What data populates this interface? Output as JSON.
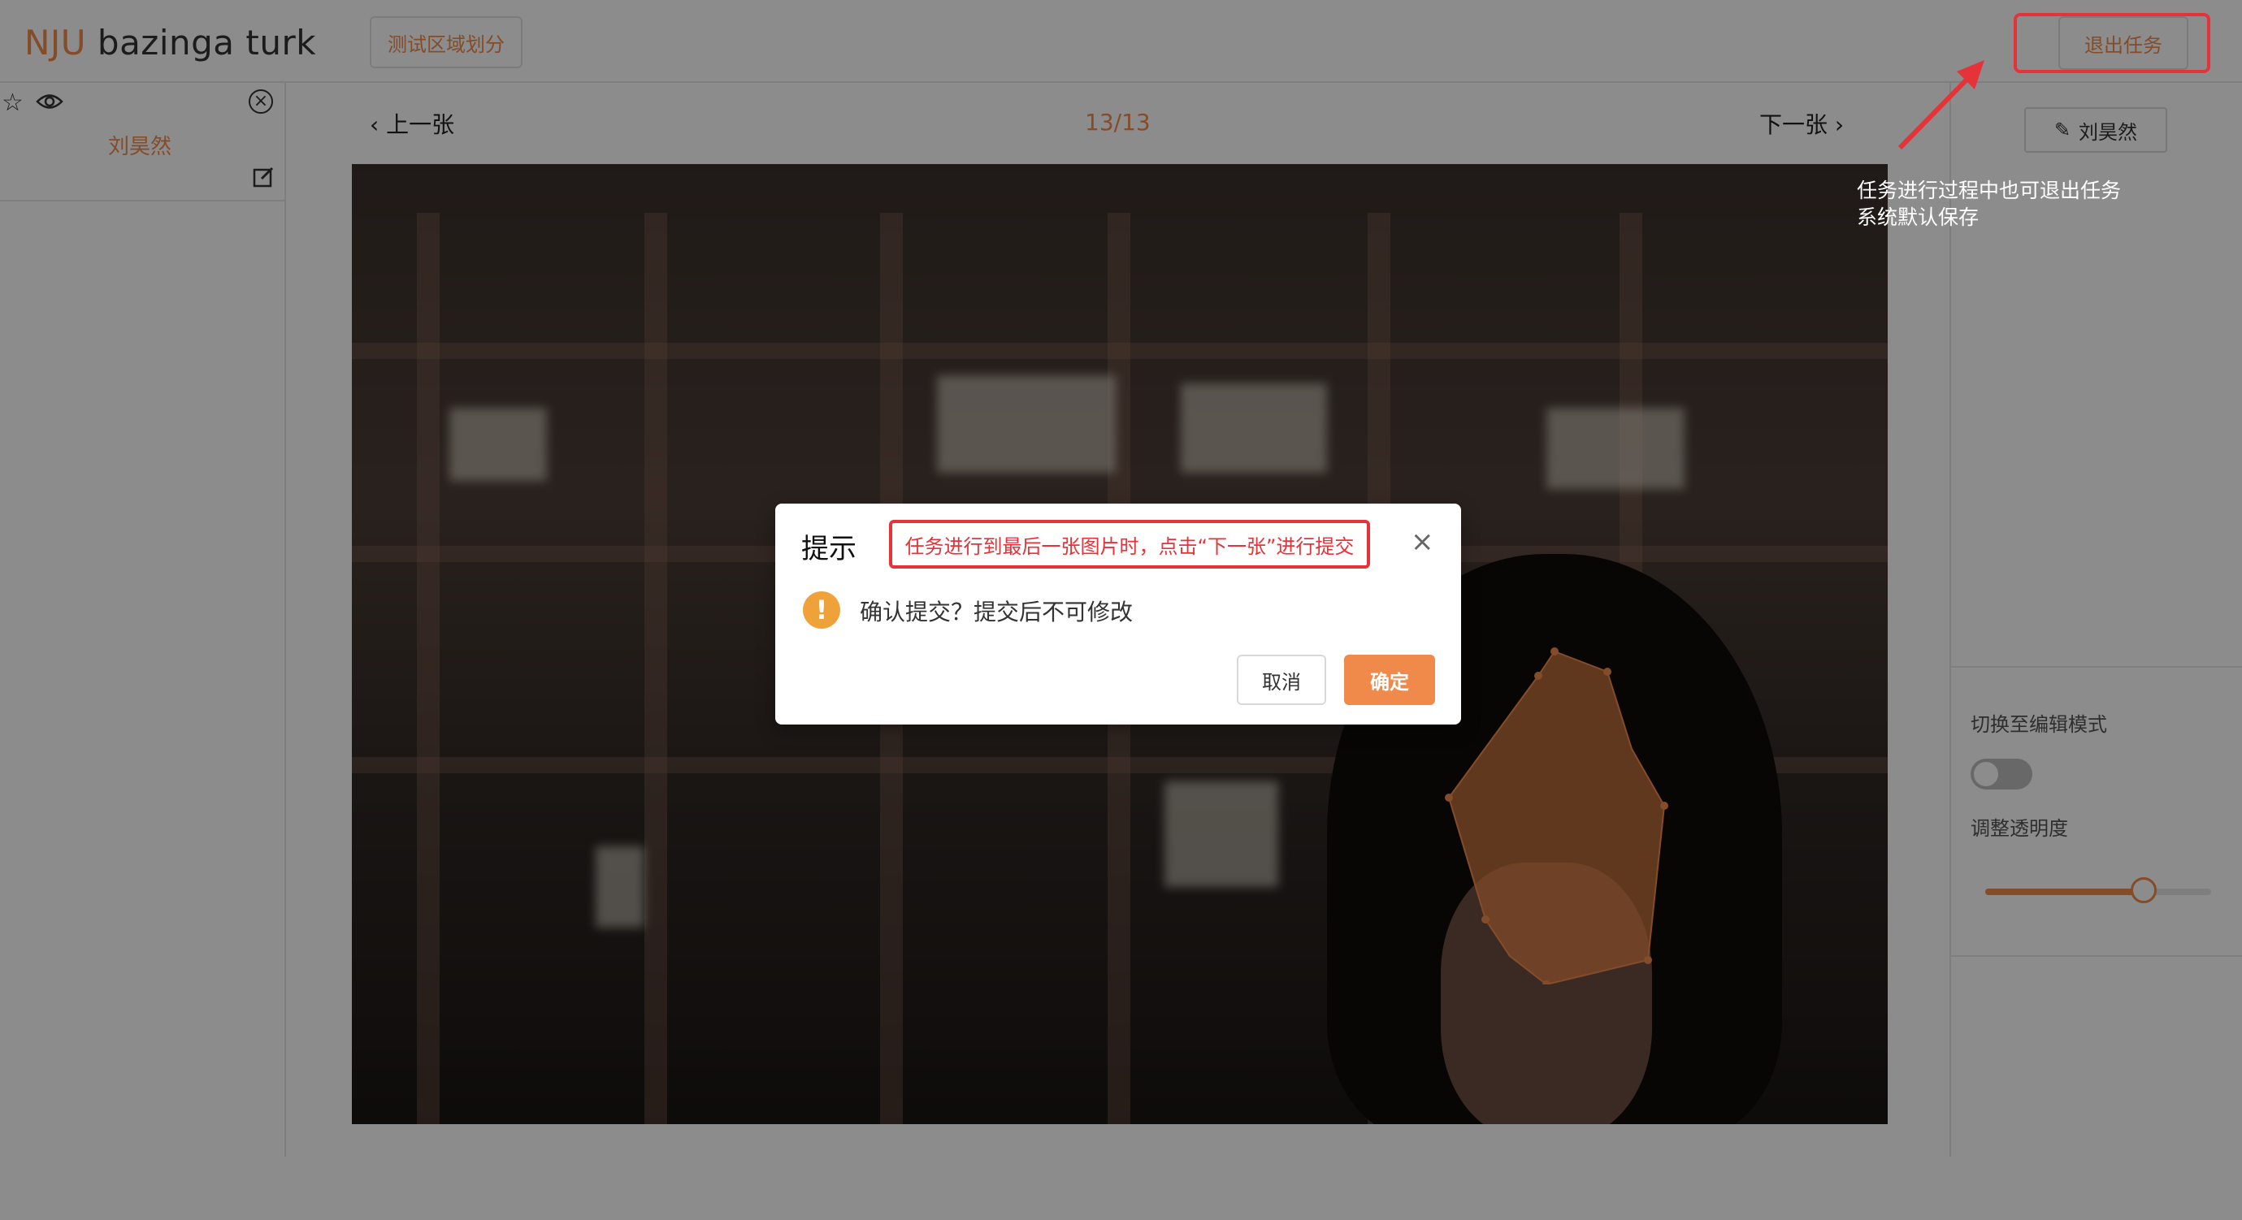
{
  "header": {
    "logo_prefix": "NJU",
    "logo_name": "bazinga turk",
    "region_button": "测试区域划分",
    "exit_button": "退出任务"
  },
  "left_panel": {
    "annotation_name": "刘昊然",
    "icons": [
      "star-icon",
      "eye-icon",
      "close-circle-icon",
      "edit-icon"
    ]
  },
  "center": {
    "prev_label": "上一张",
    "counter": "13/13",
    "next_label": "下一张"
  },
  "right_panel": {
    "user_button": "刘昊然",
    "switch_label": "切换至编辑模式",
    "switch_on": false,
    "opacity_label": "调整透明度",
    "opacity_value": 0.7
  },
  "annotations": {
    "exit_note_line1": "任务进行过程中也可退出任务",
    "exit_note_line2": "系统默认保存",
    "modal_hint": "任务进行到最后一张图片时，点击“下一张”进行提交"
  },
  "modal": {
    "title": "提示",
    "message": "确认提交？提交后不可修改",
    "cancel": "取消",
    "confirm": "确定"
  },
  "colors": {
    "accent": "#f08a4b",
    "annotation_red": "#e5333a",
    "warning": "#f0a23a"
  }
}
